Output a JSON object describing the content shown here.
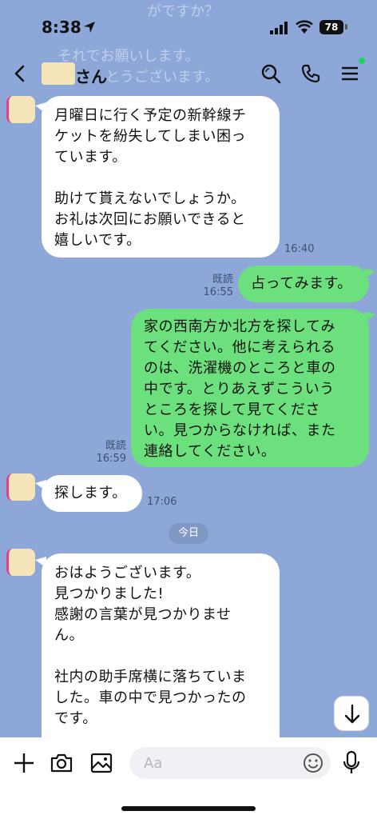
{
  "status_bar": {
    "time": "8:38",
    "battery": "78"
  },
  "background_ghost": {
    "line1": "がですか？",
    "line2": "それでお願いします。",
    "line3": "とうございます。"
  },
  "header": {
    "contact_suffix": "さん"
  },
  "messages": [
    {
      "side": "left",
      "text": "月曜日に行く予定の新幹線チ\nケットを紛失してしまい困っ\nています。\n\n助けて貰えないでしょうか。\nお礼は次回にお願いできると\n嬉しいです。",
      "time": "16:40",
      "read": ""
    },
    {
      "side": "right",
      "text": "占ってみます。",
      "time": "16:55",
      "read": "既読"
    },
    {
      "side": "right",
      "text": "家の西南方か北方を探してみ\nてください。他に考えられる\nのは、洗濯機のところと車の\n中です。とりあえずこういう\nところを探して見てくださ\nい。見つからなければ、また\n連絡してください。",
      "time": "16:59",
      "read": "既読"
    },
    {
      "side": "left",
      "text": "探します。",
      "time": "17:06",
      "read": ""
    },
    {
      "side": "left",
      "text": "おはようございます。\n見つかりました!\n感謝の言葉が見つかりませ\nん。\n\n社内の助手席横に落ちていま\nした。車の中で見つかったの\nです。",
      "time": "",
      "read": ""
    }
  ],
  "date_separator": "今日",
  "input": {
    "placeholder": "Aa"
  },
  "colors": {
    "background": "#8da7d8",
    "outgoing": "#6be07c",
    "incoming": "#ffffff",
    "online": "#1fd35a"
  }
}
